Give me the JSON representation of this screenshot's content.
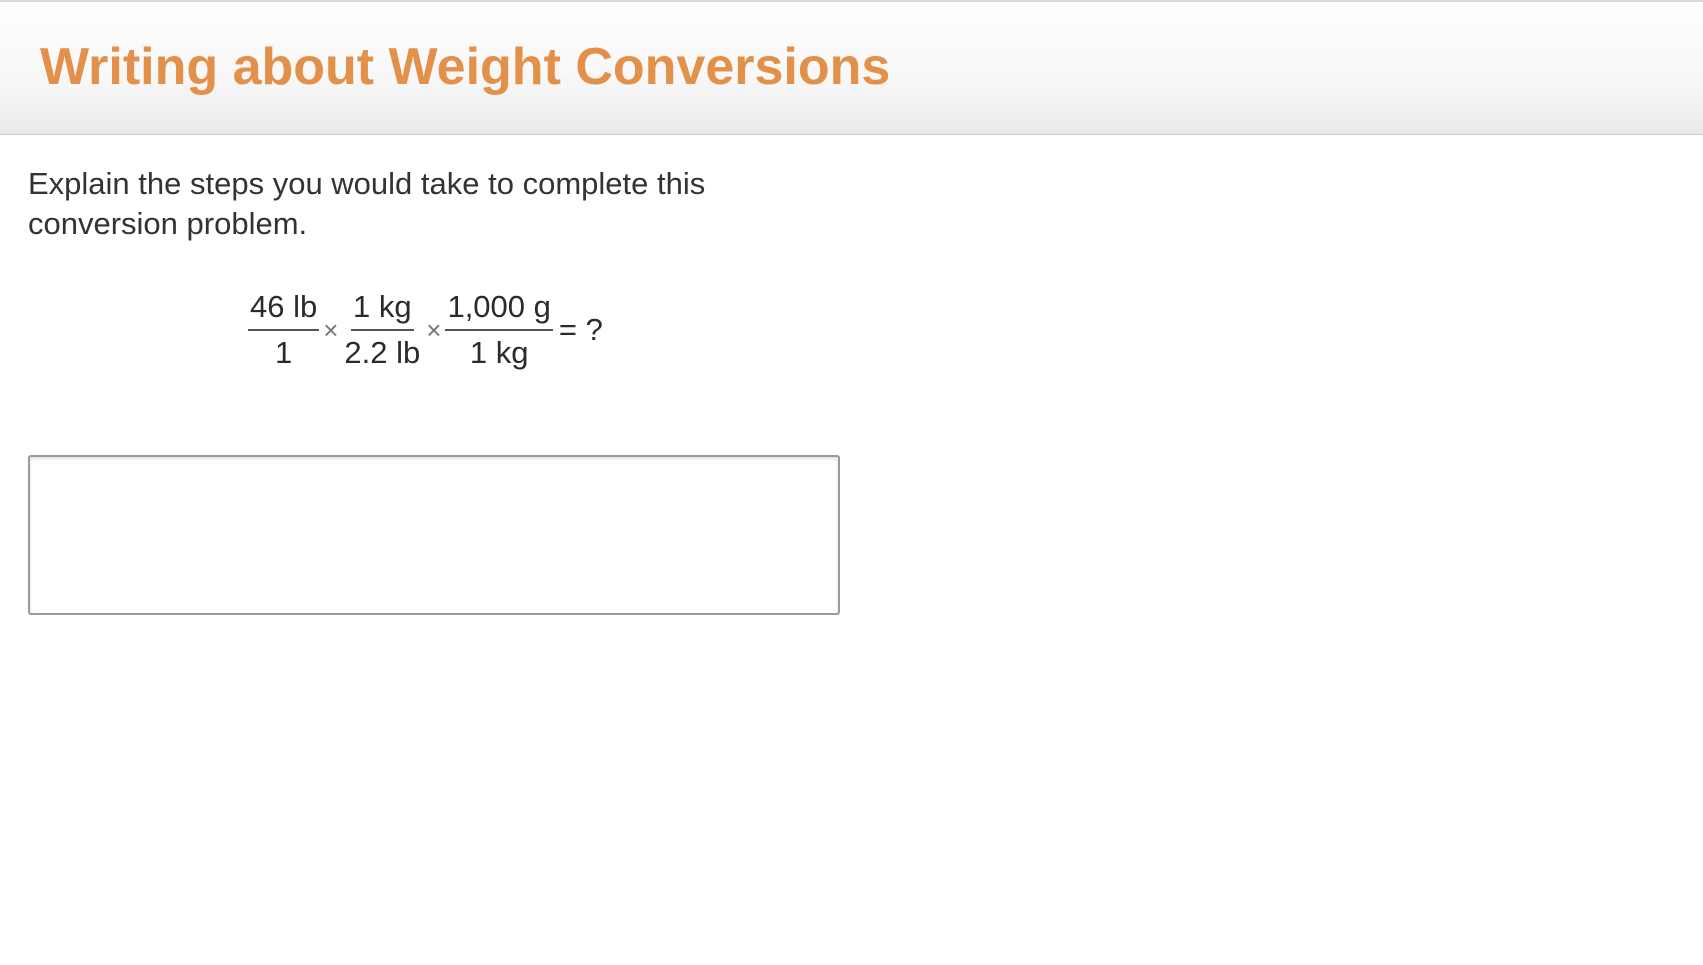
{
  "header": {
    "title": "Writing about Weight Conversions"
  },
  "question": {
    "prompt": "Explain the steps you would take to complete this conversion problem."
  },
  "equation": {
    "fractions": [
      {
        "numerator": "46 lb",
        "denominator": "1"
      },
      {
        "numerator": "1 kg",
        "denominator": "2.2 lb"
      },
      {
        "numerator": "1,000 g",
        "denominator": "1 kg"
      }
    ],
    "operator": "×",
    "result": "= ?"
  },
  "answer": {
    "value": "",
    "placeholder": ""
  },
  "colors": {
    "title": "#e3914a",
    "text": "#333333",
    "border": "#9a9a9a"
  }
}
